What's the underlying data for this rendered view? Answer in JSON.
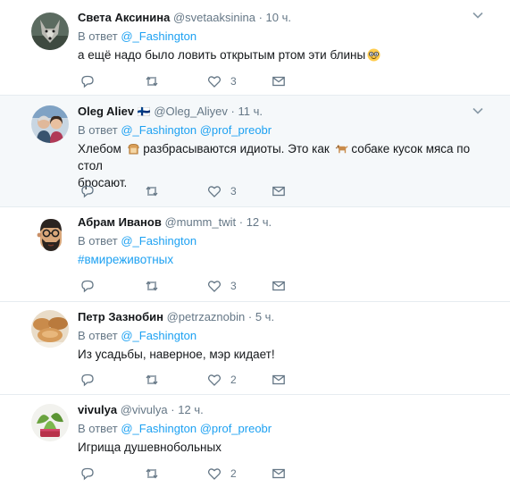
{
  "tweets": [
    {
      "name": "Света Аксинина",
      "handle": "@svetaaksinina",
      "time": "10 ч.",
      "reply_prefix": "В ответ",
      "mentions": [
        "@_Fashington"
      ],
      "text": "а ещё надо было ловить открытым ртом эти блины",
      "emoji": "nerd-face",
      "likes": "3"
    },
    {
      "name": "Oleg Aliev",
      "flag": "🇫🇮",
      "handle": "@Oleg_Aliyev",
      "time": "11 ч.",
      "reply_prefix": "В ответ",
      "mentions": [
        "@_Fashington",
        "@prof_preobr"
      ],
      "text_a": "Хлебом",
      "text_b": "разбрасываются идиоты. Это как",
      "text_c": "собаке кусок мяса по стол",
      "text_d": "бросают.",
      "likes": "3"
    },
    {
      "name": "Абрам Иванов",
      "handle": "@mumm_twit",
      "time": "12 ч.",
      "reply_prefix": "В ответ",
      "mentions": [
        "@_Fashington"
      ],
      "text": "#вмиреживотных",
      "likes": "3"
    },
    {
      "name": "Петр Зазнобин",
      "handle": "@petrzaznobin",
      "time": "5 ч.",
      "reply_prefix": "В ответ",
      "mentions": [
        "@_Fashington"
      ],
      "text": "Из усадьбы, наверное, мэр кидает!",
      "likes": "2"
    },
    {
      "name": "vivulya",
      "handle": "@vivulya",
      "time": "12 ч.",
      "reply_prefix": "В ответ",
      "mentions": [
        "@_Fashington",
        "@prof_preobr"
      ],
      "text": "Игрища душевнобольных",
      "likes": "2"
    }
  ],
  "separator": "·",
  "colors": {
    "accent": "#1da1f2",
    "muted": "#657786",
    "highlight_bg": "#f5f8fa",
    "border": "#e6ecf0"
  },
  "icons": [
    "reply-icon",
    "retweet-icon",
    "like-icon",
    "message-icon",
    "chevron-down-icon",
    "bread-emoji",
    "dog-emoji",
    "nerd-face-emoji"
  ]
}
